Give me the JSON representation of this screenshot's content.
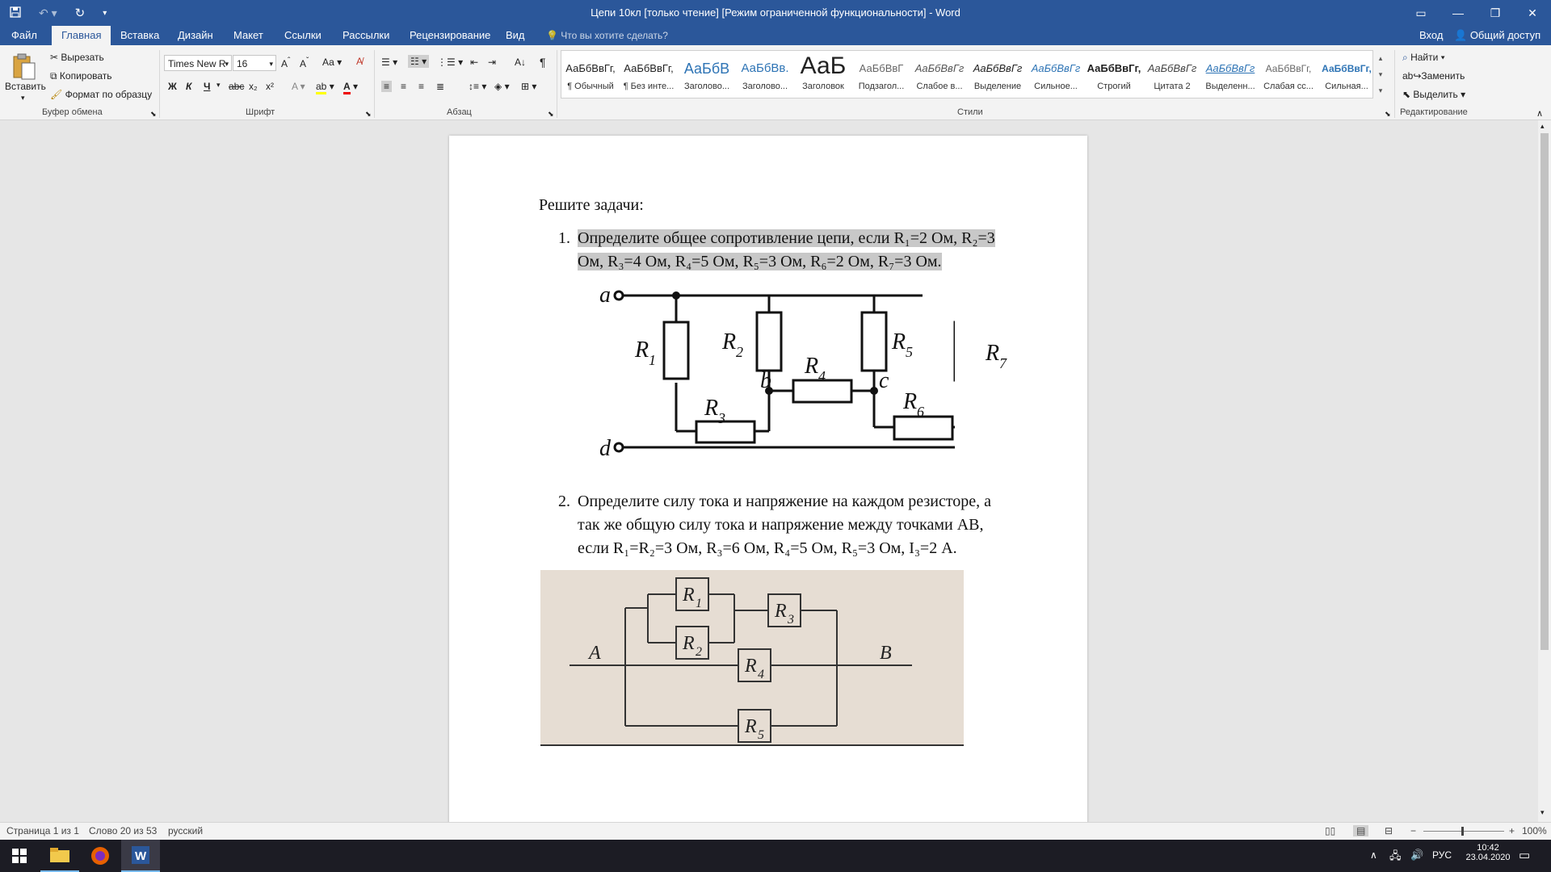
{
  "window": {
    "title": "Цепи 10кл  [только чтение] [Режим ограниченной функциональности] - Word"
  },
  "tabs": [
    "Файл",
    "Главная",
    "Вставка",
    "Дизайн",
    "Макет",
    "Ссылки",
    "Рассылки",
    "Рецензирование",
    "Вид"
  ],
  "tell_me": "Что вы хотите сделать?",
  "account": {
    "signin": "Вход",
    "share": "Общий доступ"
  },
  "clipboard": {
    "paste": "Вставить",
    "cut": "Вырезать",
    "copy": "Копировать",
    "format_painter": "Формат по образцу",
    "label": "Буфер обмена"
  },
  "font": {
    "name": "Times New R",
    "size": "16",
    "label": "Шрифт",
    "case": "Аа"
  },
  "paragraph": {
    "label": "Абзац"
  },
  "styles": {
    "label": "Стили",
    "items": [
      {
        "preview": "АаБбВвГг,",
        "name": "¶ Обычный"
      },
      {
        "preview": "АаБбВвГг,",
        "name": "¶ Без инте..."
      },
      {
        "preview": "АаБбВ",
        "name": "Заголово..."
      },
      {
        "preview": "АаБбВв.",
        "name": "Заголово..."
      },
      {
        "preview": "АаБ",
        "name": "Заголовок"
      },
      {
        "preview": "АаБбВвГ",
        "name": "Подзагол..."
      },
      {
        "preview": "АаБбВвГг",
        "name": "Слабое в..."
      },
      {
        "preview": "АаБбВвГг",
        "name": "Выделение"
      },
      {
        "preview": "АаБбВвГг",
        "name": "Сильное..."
      },
      {
        "preview": "АаБбВвГг,",
        "name": "Строгий"
      },
      {
        "preview": "АаБбВвГг",
        "name": "Цитата 2"
      },
      {
        "preview": "АаБбВвГг",
        "name": "Выделенн..."
      },
      {
        "preview": "АаБбВвГг,",
        "name": "Слабая сс..."
      },
      {
        "preview": "АаБбВвГг,",
        "name": "Сильная..."
      }
    ]
  },
  "editing": {
    "label": "Редактирование",
    "find": "Найти",
    "replace": "Заменить",
    "select": "Выделить"
  },
  "document": {
    "heading": "Решите задачи:",
    "task1_num": "1.",
    "task1_line1": "Определите общее сопротивление цепи, если R₁=2 Ом, R₂=3",
    "task1_line2": "Ом, R₃=4 Ом, R₄=5 Ом, R₅=3 Ом, R₆=2 Ом, R₇=3 Ом.",
    "task2_num": "2.",
    "task2_line1": "Определите силу тока и напряжение на каждом резисторе, а",
    "task2_line2": "так же общую силу тока и напряжение между точками AB,",
    "task2_line3": "если R₁=R₂=3 Ом, R₃=6 Ом, R₄=5 Ом, R₅=3 Ом, I₃=2 А.",
    "fig1": {
      "a": "a",
      "b": "b",
      "c": "c",
      "d": "d",
      "R1": "R",
      "R1s": "1",
      "R2": "R",
      "R2s": "2",
      "R3": "R",
      "R3s": "3",
      "R4": "R",
      "R4s": "4",
      "R5": "R",
      "R5s": "5",
      "R6": "R",
      "R6s": "6",
      "R7": "R",
      "R7s": "7"
    },
    "fig2": {
      "A": "A",
      "B": "B",
      "R1": "R",
      "R1s": "1",
      "R2": "R",
      "R2s": "2",
      "R3": "R",
      "R3s": "3",
      "R4": "R",
      "R4s": "4",
      "R5": "R",
      "R5s": "5"
    }
  },
  "status": {
    "page": "Страница 1 из 1",
    "words": "Слово 20 из 53",
    "lang": "русский",
    "zoom": "100%"
  },
  "taskbar": {
    "lang": "РУС",
    "time": "10:42",
    "date": "23.04.2020"
  }
}
